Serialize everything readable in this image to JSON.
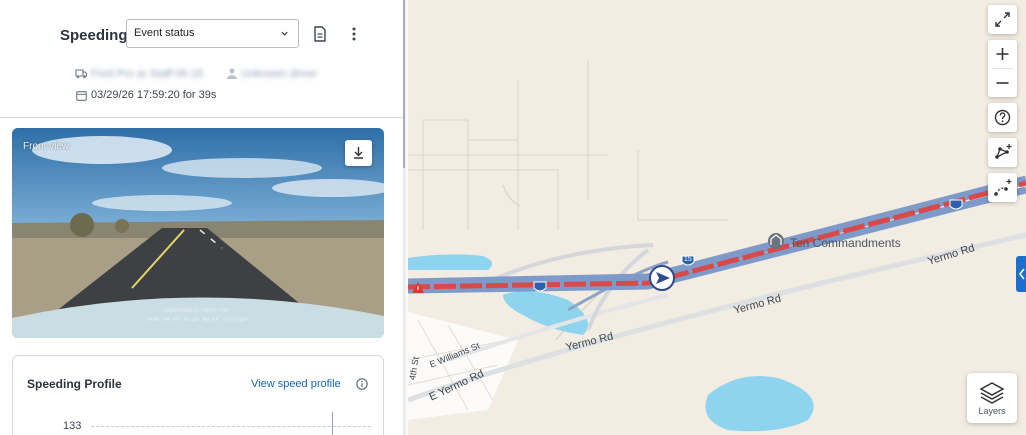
{
  "event": {
    "title": "Speeding",
    "status_select": "Event status",
    "vehicle_name": "Ford Pro ar Staff 06-15",
    "driver_name": "Unknown driver",
    "timestamp": "03/29/26 17:59:20 for 39s"
  },
  "dashcam": {
    "label": "Front view",
    "overlay_date": "03/29/2026 07:59:53 PM",
    "overlay_coords": "N34° 54' 40\" W116° 48' 14\" 79.9 mph"
  },
  "speeding_profile": {
    "title": "Speeding Profile",
    "link": "View speed profile",
    "y_tick": "133"
  },
  "map": {
    "labels": {
      "ten_commandments": "Ten Commandments",
      "yermo_rd_1": "Yermo Rd",
      "yermo_rd_2": "Yermo Rd",
      "yermo_rd_3": "Yermo Rd",
      "e_williams": "E Williams St",
      "e_yermo": "E Yermo Rd",
      "fourth_st": "4th St",
      "interstate": "15"
    },
    "layers_label": "Layers"
  },
  "colors": {
    "route_red": "#d84a4a",
    "highway_blue": "#7d9ac9",
    "water": "#8fd4ee",
    "accent_blue": "#1a6fd1"
  }
}
